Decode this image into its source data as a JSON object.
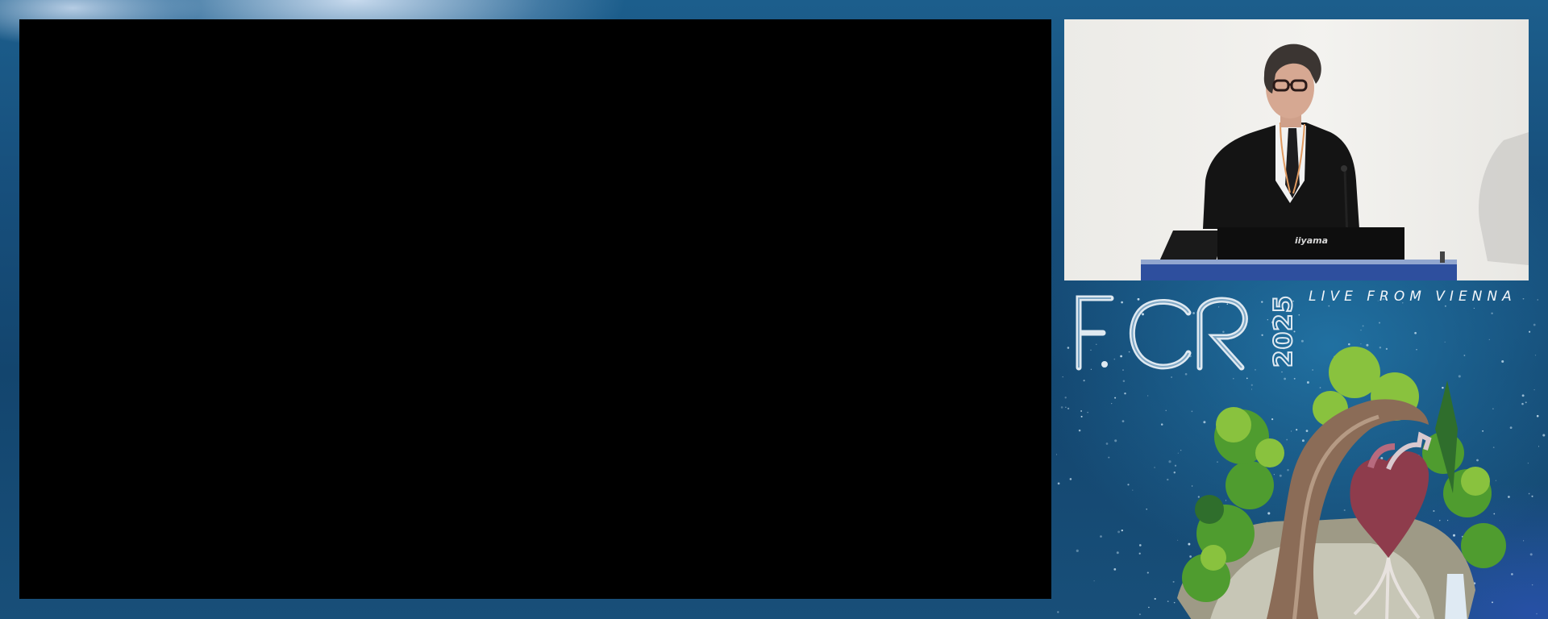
{
  "event": {
    "live_label": "LIVE FROM VIENNA",
    "logo_text": "ECR 2025"
  },
  "slide": {
    "state": "blank"
  },
  "speaker_video": {
    "monitor_brand": "iiyama"
  },
  "icons": {
    "logo": "ecr-2025-logo",
    "artwork": "tree-heart-island-icon"
  },
  "colors": {
    "background": "#174f7c",
    "slide": "#000000",
    "text": "#f2f6fa"
  }
}
